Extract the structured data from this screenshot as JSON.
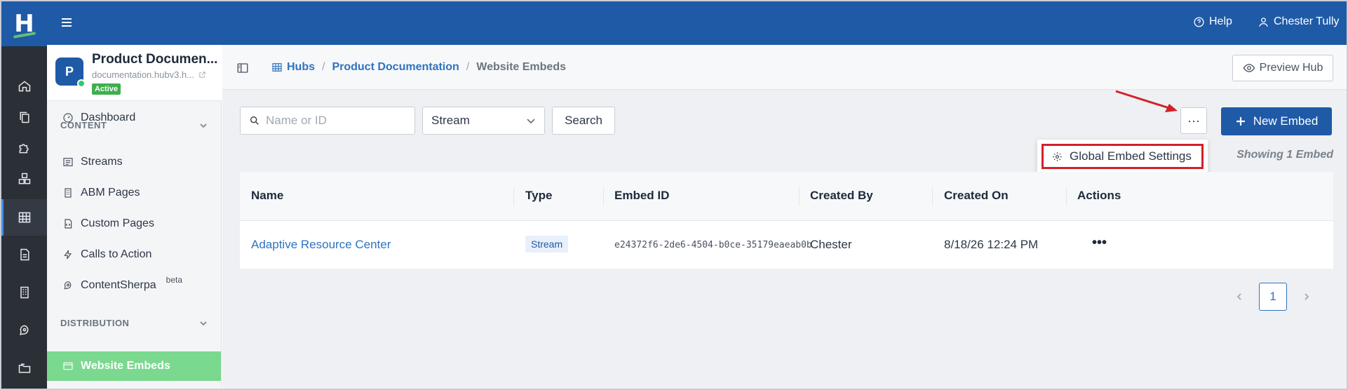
{
  "rail": {
    "logo": "H",
    "items": [
      "home-icon",
      "copy-icon",
      "puzzle-icon",
      "boxes-icon",
      "grid-icon",
      "document-icon",
      "building-icon",
      "brain-icon",
      "folder-icon"
    ]
  },
  "topbar": {
    "help": "Help",
    "user": "Chester Tully"
  },
  "hub": {
    "avatar": "P",
    "name": "Product Documen...",
    "url": "documentation.hubv3.h...",
    "status": "Active"
  },
  "sidebar": {
    "dashboard": "Dashboard",
    "content_section": "CONTENT",
    "streams": "Streams",
    "abm_pages": "ABM Pages",
    "custom_pages": "Custom Pages",
    "calls_to_action": "Calls to Action",
    "contentsherpa": "ContentSherpa",
    "beta": "beta",
    "distribution_section": "DISTRIBUTION",
    "website_embeds": "Website Embeds"
  },
  "breadcrumb": {
    "hubs": "Hubs",
    "sep": "/",
    "hub": "Product Documentation",
    "current": "Website Embeds"
  },
  "toolbar": {
    "preview": "Preview Hub",
    "search_placeholder": "Name or ID",
    "filter_value": "Stream",
    "search_button": "Search",
    "more": "···",
    "new_embed": "New Embed"
  },
  "menu": {
    "global_settings": "Global Embed Settings"
  },
  "showing": "Showing 1 Embed",
  "table": {
    "headers": [
      "Name",
      "Type",
      "Embed ID",
      "Created By",
      "Created On",
      "Actions"
    ],
    "rows": [
      {
        "name": "Adaptive Resource Center",
        "type": "Stream",
        "embed_id": "e24372f6-2de6-4504-b0ce-35179eaeab0b",
        "created_by": "Chester",
        "created_on": "8/18/26 12:24 PM",
        "actions": "•••"
      }
    ]
  },
  "pagination": {
    "current": "1"
  },
  "colors": {
    "brand": "#1f5aa6",
    "rail": "#2b2f36",
    "active_nav": "#7bd88f",
    "highlight": "#d3202a",
    "link": "#2f73c0"
  }
}
